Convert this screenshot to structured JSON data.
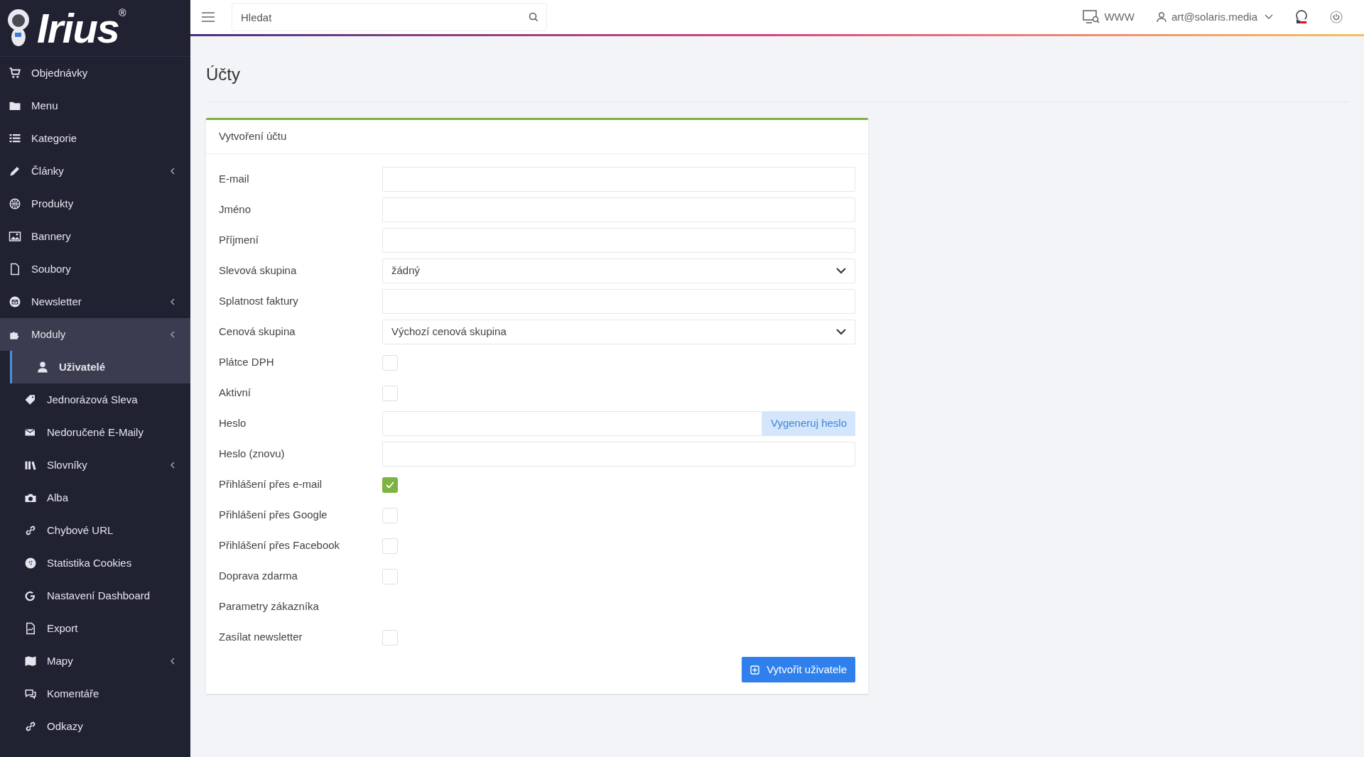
{
  "logo": {
    "text": "Irius",
    "mark": "®"
  },
  "sidebar": {
    "items": [
      {
        "label": "Objednávky",
        "has_submenu": false,
        "expanded": false
      },
      {
        "label": "Menu",
        "has_submenu": false,
        "expanded": false
      },
      {
        "label": "Kategorie",
        "has_submenu": false,
        "expanded": false
      },
      {
        "label": "Články",
        "has_submenu": true,
        "expanded": false
      },
      {
        "label": "Produkty",
        "has_submenu": false,
        "expanded": false
      },
      {
        "label": "Bannery",
        "has_submenu": false,
        "expanded": false
      },
      {
        "label": "Soubory",
        "has_submenu": false,
        "expanded": false
      },
      {
        "label": "Newsletter",
        "has_submenu": true,
        "expanded": false
      },
      {
        "label": "Moduly",
        "has_submenu": true,
        "expanded": true,
        "children": [
          {
            "label": "Uživatelé",
            "has_submenu": false,
            "selected": true
          },
          {
            "label": "Jednorázová Sleva",
            "has_submenu": false,
            "selected": false
          },
          {
            "label": "Nedoručené E-Maily",
            "has_submenu": false,
            "selected": false
          },
          {
            "label": "Slovníky",
            "has_submenu": true,
            "selected": false
          },
          {
            "label": "Alba",
            "has_submenu": false,
            "selected": false
          },
          {
            "label": "Chybové URL",
            "has_submenu": false,
            "selected": false
          },
          {
            "label": "Statistika Cookies",
            "has_submenu": false,
            "selected": false
          },
          {
            "label": "Nastavení Dashboard",
            "has_submenu": false,
            "selected": false
          },
          {
            "label": "Export",
            "has_submenu": false,
            "selected": false
          },
          {
            "label": "Mapy",
            "has_submenu": true,
            "selected": false
          },
          {
            "label": "Komentáře",
            "has_submenu": false,
            "selected": false
          },
          {
            "label": "Odkazy",
            "has_submenu": false,
            "selected": false
          }
        ]
      }
    ]
  },
  "topbar": {
    "search": {
      "placeholder": "Hledat"
    },
    "www": "WWW",
    "user": "art@solaris.media"
  },
  "page": {
    "title": "Účty"
  },
  "card": {
    "title": "Vytvoření účtu",
    "fields": [
      {
        "kind": "text",
        "label": "E-mail"
      },
      {
        "kind": "text",
        "label": "Jméno"
      },
      {
        "kind": "text",
        "label": "Příjmení"
      },
      {
        "kind": "select",
        "label": "Slevová skupina",
        "value": "žádný"
      },
      {
        "kind": "text",
        "label": "Splatnost faktury"
      },
      {
        "kind": "select",
        "label": "Cenová skupina",
        "value": "Výchozí cenová skupina"
      },
      {
        "kind": "checkbox",
        "label": "Plátce DPH",
        "checked": false
      },
      {
        "kind": "checkbox",
        "label": "Aktivní",
        "checked": false
      },
      {
        "kind": "password",
        "label": "Heslo",
        "button": "Vygeneruj heslo"
      },
      {
        "kind": "text",
        "label": "Heslo (znovu)"
      },
      {
        "kind": "checkbox",
        "label": "Přihlášení přes e-mail",
        "checked": true
      },
      {
        "kind": "checkbox",
        "label": "Přihlášení přes Google",
        "checked": false
      },
      {
        "kind": "checkbox",
        "label": "Přihlášení přes Facebook",
        "checked": false
      },
      {
        "kind": "checkbox",
        "label": "Doprava zdarma",
        "checked": false
      },
      {
        "kind": "heading",
        "label": "Parametry zákazníka"
      },
      {
        "kind": "checkbox",
        "label": "Zasílat newsletter",
        "checked": false
      }
    ],
    "submit": "Vytvořit uživatele"
  }
}
